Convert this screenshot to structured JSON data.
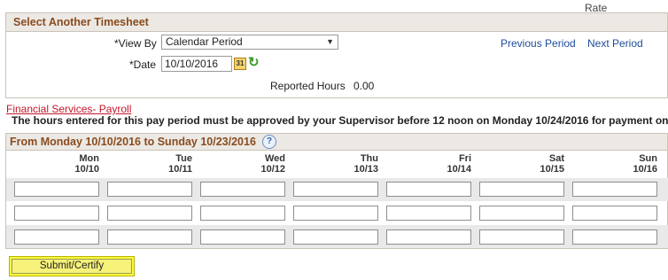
{
  "top_label": "Rate",
  "select_timesheet": {
    "title": "Select Another Timesheet",
    "view_by_label": "*View By",
    "view_by_value": "Calendar Period",
    "date_label": "*Date",
    "date_value": "10/10/2016",
    "calendar_icon_text": "31",
    "previous_period": "Previous Period",
    "next_period": "Next Period",
    "reported_hours_label": "Reported Hours",
    "reported_hours_value": "0.00"
  },
  "financial_link": "Financial Services- Payroll",
  "notice": "The hours entered for this pay period must be approved by your Supervisor before 12 noon on Monday 10/24/2016  for payment on Friday",
  "grid": {
    "title": "From Monday 10/10/2016 to Sunday 10/23/2016",
    "help_icon_text": "?",
    "days": [
      {
        "name": "Mon",
        "date": "10/10"
      },
      {
        "name": "Tue",
        "date": "10/11"
      },
      {
        "name": "Wed",
        "date": "10/12"
      },
      {
        "name": "Thu",
        "date": "10/13"
      },
      {
        "name": "Fri",
        "date": "10/14"
      },
      {
        "name": "Sat",
        "date": "10/15"
      },
      {
        "name": "Sun",
        "date": "10/16"
      }
    ],
    "rows": [
      [
        "",
        "",
        "",
        "",
        "",
        "",
        ""
      ],
      [
        "",
        "",
        "",
        "",
        "",
        "",
        ""
      ],
      [
        "",
        "",
        "",
        "",
        "",
        "",
        ""
      ]
    ]
  },
  "submit_label": "Submit/Certify",
  "colors": {
    "header_text": "#8a4b1e",
    "link": "#1f4c9a",
    "financial_link": "#c4162a",
    "submit_highlight": "#fbfb3c"
  }
}
